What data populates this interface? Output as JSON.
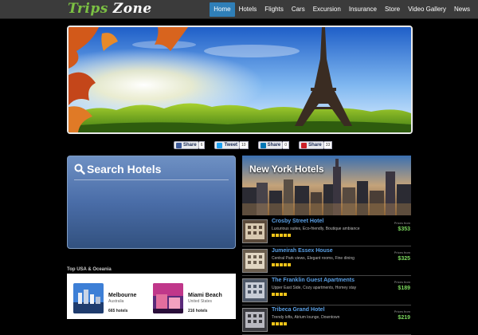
{
  "brand": {
    "word1": "Trips",
    "word2": "Zone"
  },
  "nav": {
    "items": [
      "Home",
      "Hotels",
      "Flights",
      "Cars",
      "Excursion",
      "Insurance",
      "Store",
      "Video Gallery",
      "News"
    ],
    "active": "Home"
  },
  "share": [
    {
      "label": "Share",
      "count": "6",
      "icon": "facebook-icon",
      "color": "#3b5998"
    },
    {
      "label": "Tweet",
      "count": "10",
      "icon": "twitter-icon",
      "color": "#1da1f2"
    },
    {
      "label": "Share",
      "count": "0",
      "icon": "linkedin-icon",
      "color": "#0077b5"
    },
    {
      "label": "Share",
      "count": "33",
      "icon": "pinterest-icon",
      "color": "#cb2027"
    }
  ],
  "search": {
    "title": "Search Hotels"
  },
  "usa": {
    "title": "Top USA & Oceania",
    "cards": [
      {
        "city": "Melbourne",
        "country": "Australia",
        "count": "665 hotels"
      },
      {
        "city": "Miami Beach",
        "country": "United States",
        "count": "216 hotels"
      }
    ]
  },
  "ny": {
    "title": "New York Hotels",
    "from_label": "Prices from",
    "hotels": [
      {
        "name": "Crosby Street Hotel",
        "desc": "Luxurious suites, Eco-friendly, Boutique ambiance",
        "stars": 5,
        "price": "$353"
      },
      {
        "name": "Jumeirah Essex House",
        "desc": "Central Park views, Elegant rooms, Fine dining",
        "stars": 5,
        "price": "$325"
      },
      {
        "name": "The Franklin Guest Apartments",
        "desc": "Upper East Side, Cozy apartments, Homey stay",
        "stars": 4,
        "price": "$189"
      },
      {
        "name": "Tribeca Grand Hotel",
        "desc": "Trendy lofts, Atrium lounge, Downtown",
        "stars": 4,
        "price": "$219"
      }
    ]
  },
  "colors": {
    "accent": "#2f7fb8",
    "brand_green": "#7bc043",
    "price_green": "#7bd85e",
    "link_blue": "#5aa0e6",
    "star": "#f0c419"
  }
}
